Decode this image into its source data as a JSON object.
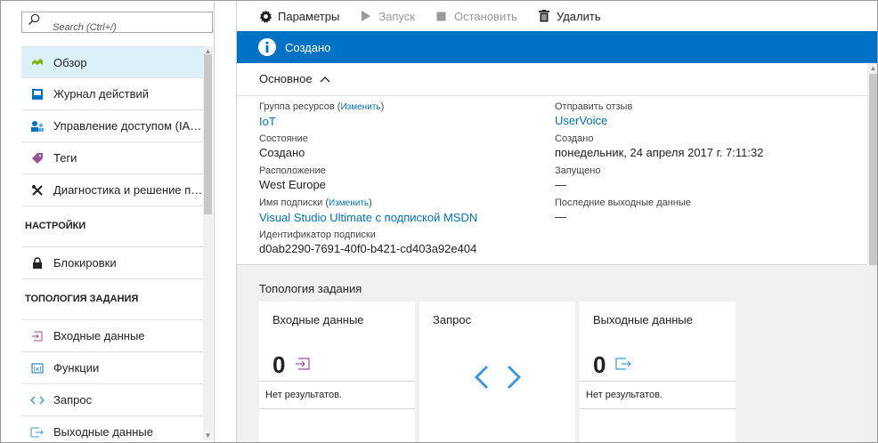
{
  "search": {
    "placeholder": "Search (Ctrl+/)"
  },
  "sidebar": {
    "items": [
      {
        "label": "Обзор",
        "icon": "overview-icon",
        "active": true
      },
      {
        "label": "Журнал действий",
        "icon": "activity-log-icon"
      },
      {
        "label": "Управление доступом (IAM)",
        "icon": "access-control-icon"
      },
      {
        "label": "Теги",
        "icon": "tag-icon"
      },
      {
        "label": "Диагностика и решение про...",
        "icon": "wrench-icon"
      }
    ],
    "settings_header": "НАСТРОЙКИ",
    "settings_items": [
      {
        "label": "Блокировки",
        "icon": "lock-icon"
      }
    ],
    "topology_header": "ТОПОЛОГИЯ ЗАДАНИЯ",
    "topology_items": [
      {
        "label": "Входные данные",
        "icon": "input-icon"
      },
      {
        "label": "Функции",
        "icon": "function-icon"
      },
      {
        "label": "Запрос",
        "icon": "query-icon"
      },
      {
        "label": "Выходные данные",
        "icon": "output-icon"
      }
    ]
  },
  "toolbar": {
    "settings_label": "Параметры",
    "start_label": "Запуск",
    "stop_label": "Остановить",
    "delete_label": "Удалить"
  },
  "banner": {
    "text": "Создано",
    "color": "#0072c6"
  },
  "essentials": {
    "header": "Основное",
    "left": {
      "resource_group_label": "Группа ресурсов",
      "resource_group_change": "Изменить",
      "resource_group_value": "IoT",
      "status_label": "Состояние",
      "status_value": "Создано",
      "location_label": "Расположение",
      "location_value": "West Europe",
      "subscription_label": "Имя подписки",
      "subscription_change": "Изменить",
      "subscription_value": "Visual Studio Ultimate с подпиской MSDN",
      "subscription_id_label": "Идентификатор подписки",
      "subscription_id_value": "d0ab2290-7691-40f0-b421-cd403a92e404"
    },
    "right": {
      "feedback_label": "Отправить отзыв",
      "feedback_value": "UserVoice",
      "created_label": "Создано",
      "created_value": "понедельник, 24 апреля 2017 г. 7:11:32",
      "started_label": "Запущено",
      "started_value": "—",
      "last_output_label": "Последние выходные данные",
      "last_output_value": "—"
    }
  },
  "topology": {
    "title": "Топология задания",
    "inputs": {
      "title": "Входные данные",
      "count": "0",
      "empty": "Нет результатов."
    },
    "query": {
      "title": "Запрос"
    },
    "outputs": {
      "title": "Выходные данные",
      "count": "0",
      "empty": "Нет результатов."
    }
  },
  "colors": {
    "accent": "#0072c6",
    "active_bg": "#dcf0fa",
    "query_icon": "#3a9ad9"
  }
}
